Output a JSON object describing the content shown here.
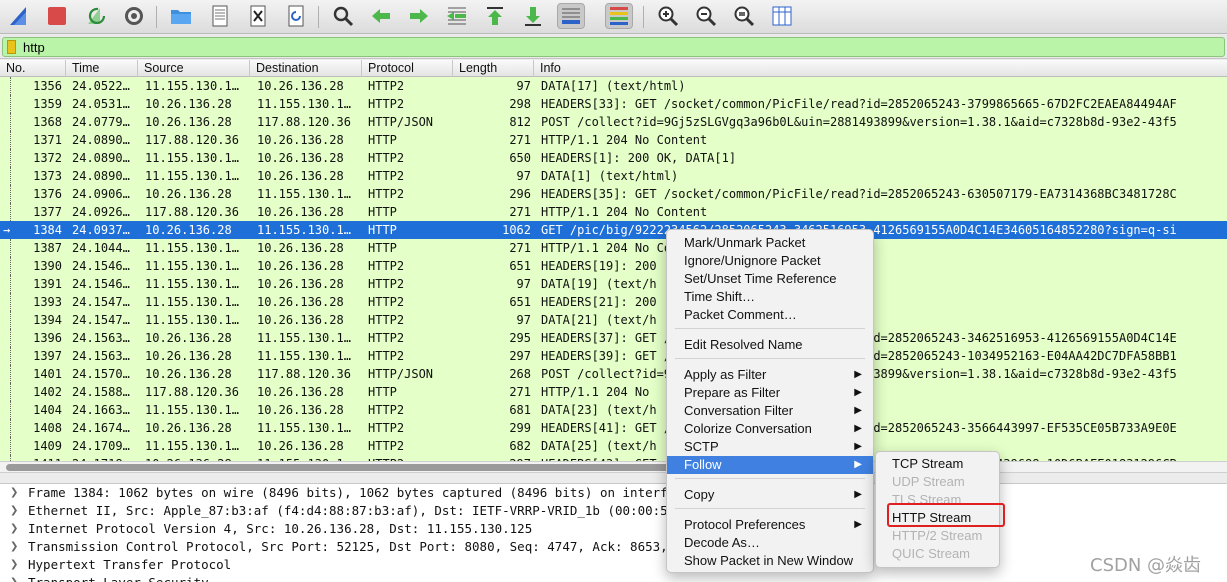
{
  "filter": {
    "value": "http"
  },
  "columns": [
    "No.",
    "Time",
    "Source",
    "Destination",
    "Protocol",
    "Length",
    "Info"
  ],
  "packets": [
    {
      "no": "1356",
      "time": "24.0522…",
      "src": "11.155.130.1…",
      "dst": "10.26.136.28",
      "proto": "HTTP2",
      "len": "97",
      "info": "DATA[17] (text/html)"
    },
    {
      "no": "1359",
      "time": "24.0531…",
      "src": "10.26.136.28",
      "dst": "11.155.130.1…",
      "proto": "HTTP2",
      "len": "298",
      "info": "HEADERS[33]: GET /socket/common/PicFile/read?id=2852065243-3799865665-67D2FC2EAEA84494AF"
    },
    {
      "no": "1368",
      "time": "24.0779…",
      "src": "10.26.136.28",
      "dst": "117.88.120.36",
      "proto": "HTTP/JSON",
      "len": "812",
      "info": "POST /collect?id=9Gj5zSLGVgq3a96b0L&uin=2881493899&version=1.38.1&aid=c7328b8d-93e2-43f5"
    },
    {
      "no": "1371",
      "time": "24.0890…",
      "src": "117.88.120.36",
      "dst": "10.26.136.28",
      "proto": "HTTP",
      "len": "271",
      "info": "HTTP/1.1 204 No Content"
    },
    {
      "no": "1372",
      "time": "24.0890…",
      "src": "11.155.130.1…",
      "dst": "10.26.136.28",
      "proto": "HTTP2",
      "len": "650",
      "info": "HEADERS[1]: 200 OK, DATA[1]"
    },
    {
      "no": "1373",
      "time": "24.0890…",
      "src": "11.155.130.1…",
      "dst": "10.26.136.28",
      "proto": "HTTP2",
      "len": "97",
      "info": "DATA[1] (text/html)"
    },
    {
      "no": "1376",
      "time": "24.0906…",
      "src": "10.26.136.28",
      "dst": "11.155.130.1…",
      "proto": "HTTP2",
      "len": "296",
      "info": "HEADERS[35]: GET /socket/common/PicFile/read?id=2852065243-630507179-EA7314368BC3481728C"
    },
    {
      "no": "1377",
      "time": "24.0926…",
      "src": "117.88.120.36",
      "dst": "10.26.136.28",
      "proto": "HTTP",
      "len": "271",
      "info": "HTTP/1.1 204 No Content"
    },
    {
      "no": "1384",
      "time": "24.0937…",
      "src": "10.26.136.28",
      "dst": "11.155.130.1…",
      "proto": "HTTP",
      "len": "1062",
      "info": "GET /pic/big/9222234562/2852065243-3462516953-4126569155A0D4C14E34605164852280?sign=q-si"
    },
    {
      "no": "1387",
      "time": "24.1044…",
      "src": "11.155.130.1…",
      "dst": "10.26.136.28",
      "proto": "HTTP",
      "len": "271",
      "info": "HTTP/1.1 204 No Content"
    },
    {
      "no": "1390",
      "time": "24.1546…",
      "src": "11.155.130.1…",
      "dst": "10.26.136.28",
      "proto": "HTTP2",
      "len": "651",
      "info": "HEADERS[19]: 200"
    },
    {
      "no": "1391",
      "time": "24.1546…",
      "src": "11.155.130.1…",
      "dst": "10.26.136.28",
      "proto": "HTTP2",
      "len": "97",
      "info": "DATA[19] (text/h"
    },
    {
      "no": "1393",
      "time": "24.1547…",
      "src": "11.155.130.1…",
      "dst": "10.26.136.28",
      "proto": "HTTP2",
      "len": "651",
      "info": "HEADERS[21]: 200"
    },
    {
      "no": "1394",
      "time": "24.1547…",
      "src": "11.155.130.1…",
      "dst": "10.26.136.28",
      "proto": "HTTP2",
      "len": "97",
      "info": "DATA[21] (text/h"
    },
    {
      "no": "1396",
      "time": "24.1563…",
      "src": "10.26.136.28",
      "dst": "11.155.130.1…",
      "proto": "HTTP2",
      "len": "295",
      "info": "HEADERS[37]: GET /socket/common/PicFile/read?id=2852065243-3462516953-4126569155A0D4C14E"
    },
    {
      "no": "1397",
      "time": "24.1563…",
      "src": "10.26.136.28",
      "dst": "11.155.130.1…",
      "proto": "HTTP2",
      "len": "297",
      "info": "HEADERS[39]: GET /socket/common/PicFile/read?id=2852065243-1034952163-E04AA42DC7DFA58BB1"
    },
    {
      "no": "1401",
      "time": "24.1570…",
      "src": "10.26.136.28",
      "dst": "117.88.120.36",
      "proto": "HTTP/JSON",
      "len": "268",
      "info": "POST /collect?id=9Gj5zSLGVgq3a96b0L&uin=2881493899&version=1.38.1&aid=c7328b8d-93e2-43f5"
    },
    {
      "no": "1402",
      "time": "24.1588…",
      "src": "117.88.120.36",
      "dst": "10.26.136.28",
      "proto": "HTTP",
      "len": "271",
      "info": "HTTP/1.1 204 No"
    },
    {
      "no": "1404",
      "time": "24.1663…",
      "src": "11.155.130.1…",
      "dst": "10.26.136.28",
      "proto": "HTTP2",
      "len": "681",
      "info": "DATA[23] (text/h"
    },
    {
      "no": "1408",
      "time": "24.1674…",
      "src": "10.26.136.28",
      "dst": "11.155.130.1…",
      "proto": "HTTP2",
      "len": "299",
      "info": "HEADERS[41]: GET /socket/common/PicFile/read?id=2852065243-3566443997-EF535CE05B733A9E0E"
    },
    {
      "no": "1409",
      "time": "24.1709…",
      "src": "11.155.130.1…",
      "dst": "10.26.136.28",
      "proto": "HTTP2",
      "len": "682",
      "info": "DATA[25] (text/h"
    },
    {
      "no": "1411",
      "time": "24.1718…",
      "src": "10.26.136.28",
      "dst": "11.155.130.1…",
      "proto": "HTTP2",
      "len": "297",
      "info": "HEADERS[43]: GET /socket/common/PicFile/read?id=2852065243-2743439688-10D6BAEE01831296CB"
    }
  ],
  "details": [
    "Frame 1384: 1062 bytes on wire (8496 bits), 1062 bytes captured (8496 bits) on interface en0, id 0",
    "Ethernet II, Src: Apple_87:b3:af (f4:d4:88:87:b3:af), Dst: IETF-VRRP-VRID_1b (00:00:5e:00:01:1b)",
    "Internet Protocol Version 4, Src: 10.26.136.28, Dst: 11.155.130.125",
    "Transmission Control Protocol, Src Port: 52125, Dst Port: 8080, Seq: 4747, Ack: 8653, Len: 996",
    "Hypertext Transfer Protocol",
    "Transport Layer Security"
  ],
  "context_menu": {
    "items": [
      {
        "label": "Mark/Unmark Packet"
      },
      {
        "label": "Ignore/Unignore Packet"
      },
      {
        "label": "Set/Unset Time Reference"
      },
      {
        "label": "Time Shift…"
      },
      {
        "label": "Packet Comment…"
      },
      {
        "label": "Edit Resolved Name"
      },
      {
        "label": "Apply as Filter"
      },
      {
        "label": "Prepare as Filter"
      },
      {
        "label": "Conversation Filter"
      },
      {
        "label": "Colorize Conversation"
      },
      {
        "label": "SCTP"
      },
      {
        "label": "Follow"
      },
      {
        "label": "Copy"
      },
      {
        "label": "Protocol Preferences"
      },
      {
        "label": "Decode As…"
      },
      {
        "label": "Show Packet in New Window"
      }
    ],
    "submenu_arrow": "▶"
  },
  "follow_submenu": {
    "items": [
      {
        "label": "TCP Stream"
      },
      {
        "label": "UDP Stream"
      },
      {
        "label": "TLS Stream"
      },
      {
        "label": "HTTP Stream"
      },
      {
        "label": "HTTP/2 Stream"
      },
      {
        "label": "QUIC Stream"
      }
    ]
  },
  "watermark": "CSDN @焱齿",
  "colors": {
    "row_http": "#e4ffc7",
    "row_selected": "#1f6fd8",
    "filter_valid": "#b9f4a9",
    "menu_highlight": "#3f80e0",
    "annotation_box": "#e02020"
  }
}
